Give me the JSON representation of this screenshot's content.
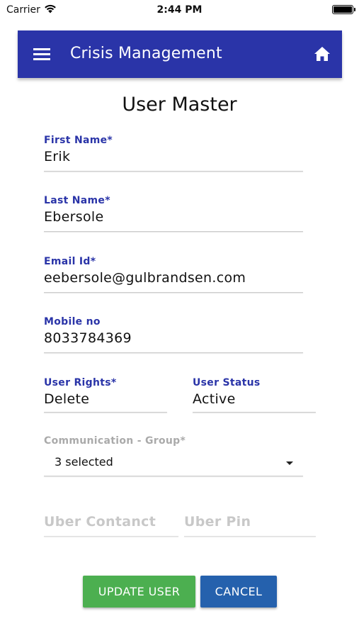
{
  "status_bar": {
    "carrier": "Carrier",
    "time": "2:44 PM"
  },
  "app_bar": {
    "title": "Crisis Management",
    "menu_icon": "hamburger-menu-icon",
    "home_icon": "home-icon",
    "color": "#2a34a8"
  },
  "page": {
    "title": "User Master"
  },
  "form": {
    "first_name": {
      "label": "First Name*",
      "value": "Erik"
    },
    "last_name": {
      "label": "Last Name*",
      "value": "Ebersole"
    },
    "email": {
      "label": "Email Id*",
      "value": "eebersole@gulbrandsen.com"
    },
    "mobile": {
      "label": "Mobile no",
      "value": "8033784369"
    },
    "user_rights": {
      "label": "User Rights*",
      "value": "Delete"
    },
    "user_status": {
      "label": "User Status",
      "value": "Active"
    },
    "communication_group": {
      "label": "Communication - Group*",
      "selected": "3 selected"
    },
    "uber_contact": {
      "placeholder": "Uber Contanct"
    },
    "uber_pin": {
      "placeholder": "Uber Pin"
    }
  },
  "buttons": {
    "update": {
      "label": "UPDATE USER",
      "color": "#4caf50"
    },
    "cancel": {
      "label": "CANCEL",
      "color": "#2561ad"
    }
  }
}
